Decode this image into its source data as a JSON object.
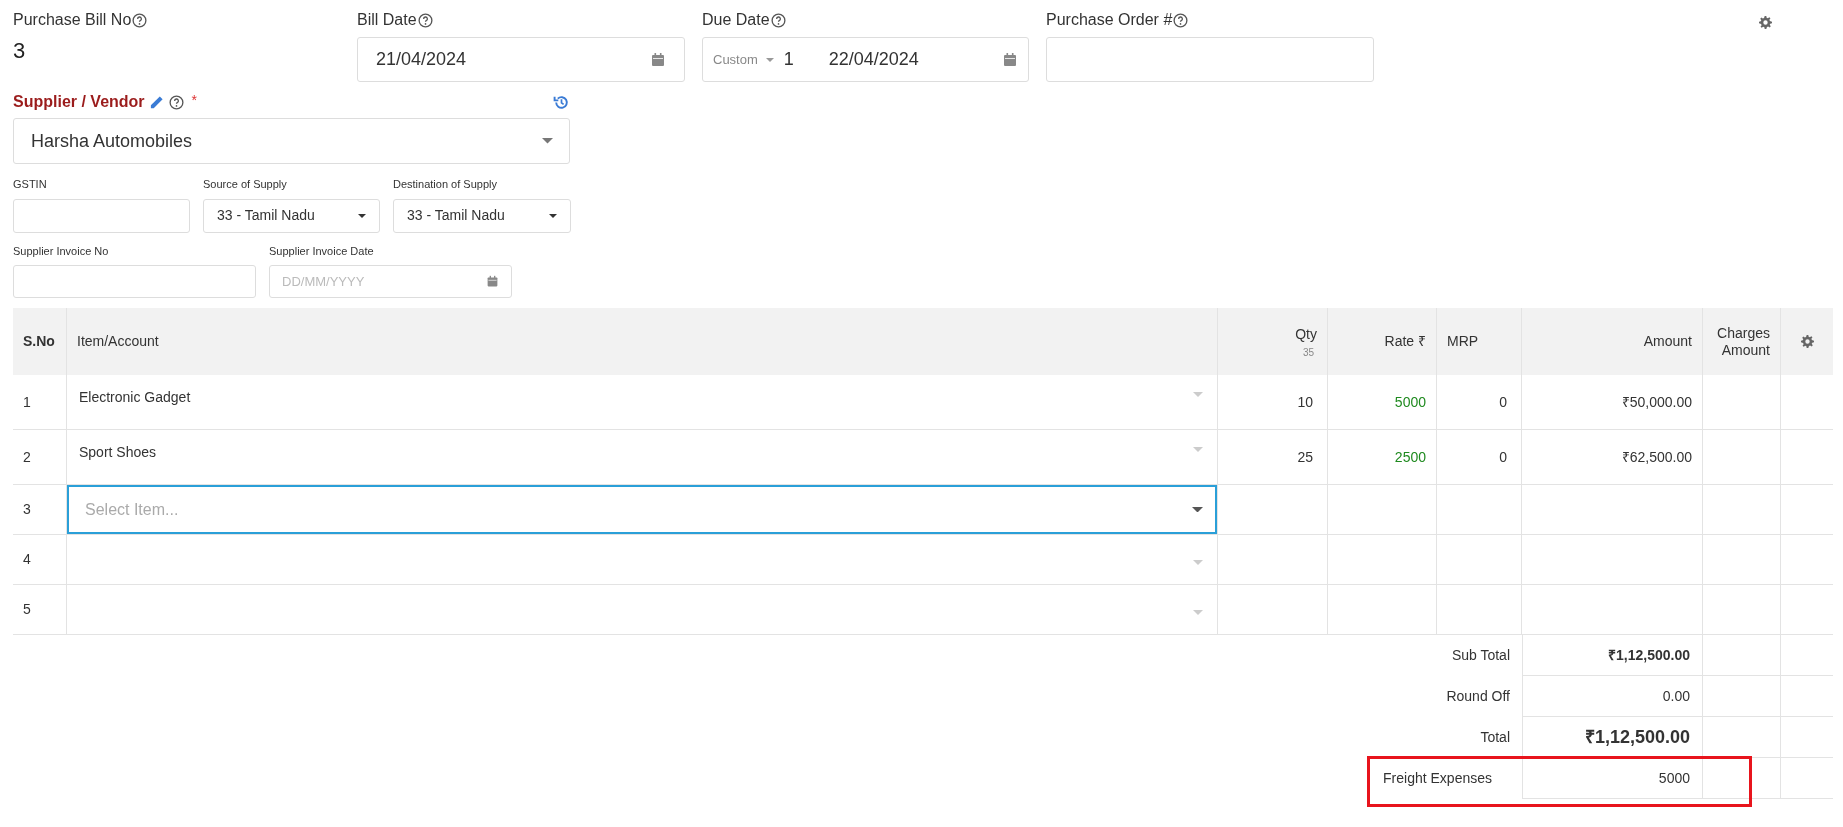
{
  "bill_no": {
    "label": "Purchase Bill No",
    "value": "3"
  },
  "bill_date": {
    "label": "Bill Date",
    "value": "21/04/2024"
  },
  "due_date": {
    "label": "Due Date",
    "term": "Custom",
    "days": "1",
    "value": "22/04/2024"
  },
  "purchase_order": {
    "label": "Purchase Order #"
  },
  "supplier": {
    "label": "Supplier / Vendor",
    "required_mark": "*",
    "value": "Harsha Automobiles"
  },
  "gstin": {
    "label": "GSTIN"
  },
  "source_of_supply": {
    "label": "Source of Supply",
    "value": "33 - Tamil Nadu"
  },
  "destination_of_supply": {
    "label": "Destination of Supply",
    "value": "33 - Tamil Nadu"
  },
  "supplier_invoice_no": {
    "label": "Supplier Invoice No"
  },
  "supplier_invoice_date": {
    "label": "Supplier Invoice Date",
    "placeholder": "DD/MM/YYYY"
  },
  "table": {
    "columns": [
      {
        "label": "S.No"
      },
      {
        "label": "Item/Account"
      },
      {
        "label": "Qty",
        "sub": "35"
      },
      {
        "label": "Rate ₹"
      },
      {
        "label": "MRP"
      },
      {
        "label": "Amount"
      },
      {
        "label": "Charges Amount"
      }
    ],
    "rows": [
      {
        "sno": "1",
        "item": "Electronic Gadget",
        "qty": "10",
        "rate": "5000",
        "mrp": "0",
        "amount": "₹50,000.00",
        "focused": false
      },
      {
        "sno": "2",
        "item": "Sport Shoes",
        "qty": "25",
        "rate": "2500",
        "mrp": "0",
        "amount": "₹62,500.00",
        "focused": false
      },
      {
        "sno": "3",
        "placeholder": "Select Item...",
        "focused": true
      },
      {
        "sno": "4",
        "focused": false
      },
      {
        "sno": "5",
        "focused": false
      }
    ]
  },
  "totals": [
    {
      "label": "Sub Total",
      "value": "₹1,12,500.00",
      "kind": "subtotal"
    },
    {
      "label": "Round Off",
      "value": "0.00",
      "kind": "plain"
    },
    {
      "label": "Total",
      "value": "₹1,12,500.00",
      "kind": "total"
    },
    {
      "label": "Freight Expenses",
      "value": "5000",
      "kind": "charge",
      "highlighted": true
    }
  ]
}
